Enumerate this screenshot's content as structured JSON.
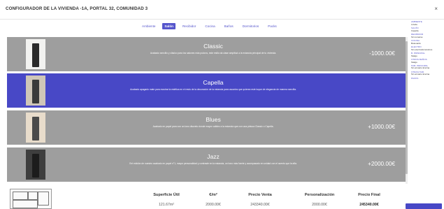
{
  "header": {
    "title": "CONFIGURADOR DE LA VIVIENDA -1A, PORTAL 32, COMUNIDAD 3",
    "close_icon": "×"
  },
  "tabs": [
    {
      "label": "Ambiente",
      "active": false
    },
    {
      "label": "Salón",
      "active": true
    },
    {
      "label": "Recibidor",
      "active": false
    },
    {
      "label": "Cocina",
      "active": false
    },
    {
      "label": "Baños",
      "active": false
    },
    {
      "label": "Dormitorios",
      "active": false
    },
    {
      "label": "Packs",
      "active": false
    }
  ],
  "options": [
    {
      "name": "Classic",
      "description": "Acabado sencillo y clásico para los salones más pulcros, este estilo da clase amplitud a la estancia principal de tu vivienda.",
      "price": "-1000.00€",
      "selected": false,
      "wall_color": "#f2f2f0",
      "door_color": "#2a2a2a"
    },
    {
      "name": "Capella",
      "description": "Acabado apagado mate para mostrar la estética en el resto de la decoración de la estancia para usuarios que quieran este toque de elegancia de manera sencilla.",
      "price": "",
      "selected": true,
      "wall_color": "#cfc6b8",
      "door_color": "#3a3a3a"
    },
    {
      "name": "Blues",
      "description": "Acabado en papel para con un tono discreto donde mayor calidez a la estancia que con una pintura Classic o Capella.",
      "price": "+1000.00€",
      "selected": false,
      "wall_color": "#e8dccb",
      "door_color": "#4a4a4a"
    },
    {
      "name": "Jazz",
      "description": "Ent edición de nuestro acabado en papel n°1, mayor personalidad y contraste en la estancia, un tono más fuerte y acompasado en unidad con el acento que la alfa.",
      "price": "+2000.00€",
      "selected": false,
      "wall_color": "#3e3e3e",
      "door_color": "#1c1c1c"
    }
  ],
  "summary": [
    {
      "label": "AMBIENTE",
      "value": "Lizette"
    },
    {
      "label": "SALÓN",
      "value": "Capella"
    },
    {
      "label": "RECIBIDOR",
      "value": "Sin tomarse"
    },
    {
      "label": "COCINA",
      "value": "Bulevardo"
    },
    {
      "label": "ELECTRO",
      "value": "Sin electrodomésticos"
    },
    {
      "label": "B. PRINCIPAL",
      "value": "Stalgo"
    },
    {
      "label": "OTROS BAÑOS",
      "value": "Stalgo"
    },
    {
      "label": "HAB. PRINCIPAL",
      "value": "Sin armario Encina"
    },
    {
      "label": "OTRAS HAB.",
      "value": "Sin armario Encina"
    },
    {
      "label": "PACKS",
      "value": ""
    }
  ],
  "totals": {
    "headers": {
      "area": "Superficie Útil",
      "price_m2": "€/m²",
      "sale_price": "Precio Venta",
      "customization": "Personalización",
      "final_price": "Precio Final"
    },
    "values": {
      "area": "121.67m²",
      "price_m2": "2000.00€",
      "sale_price": "243340.00€",
      "customization": "2000.00€",
      "final_price": "245340.00€"
    }
  },
  "colors": {
    "accent": "#4848c6",
    "option_bg": "#9e9e9e",
    "summary_label": "#5656cc"
  }
}
